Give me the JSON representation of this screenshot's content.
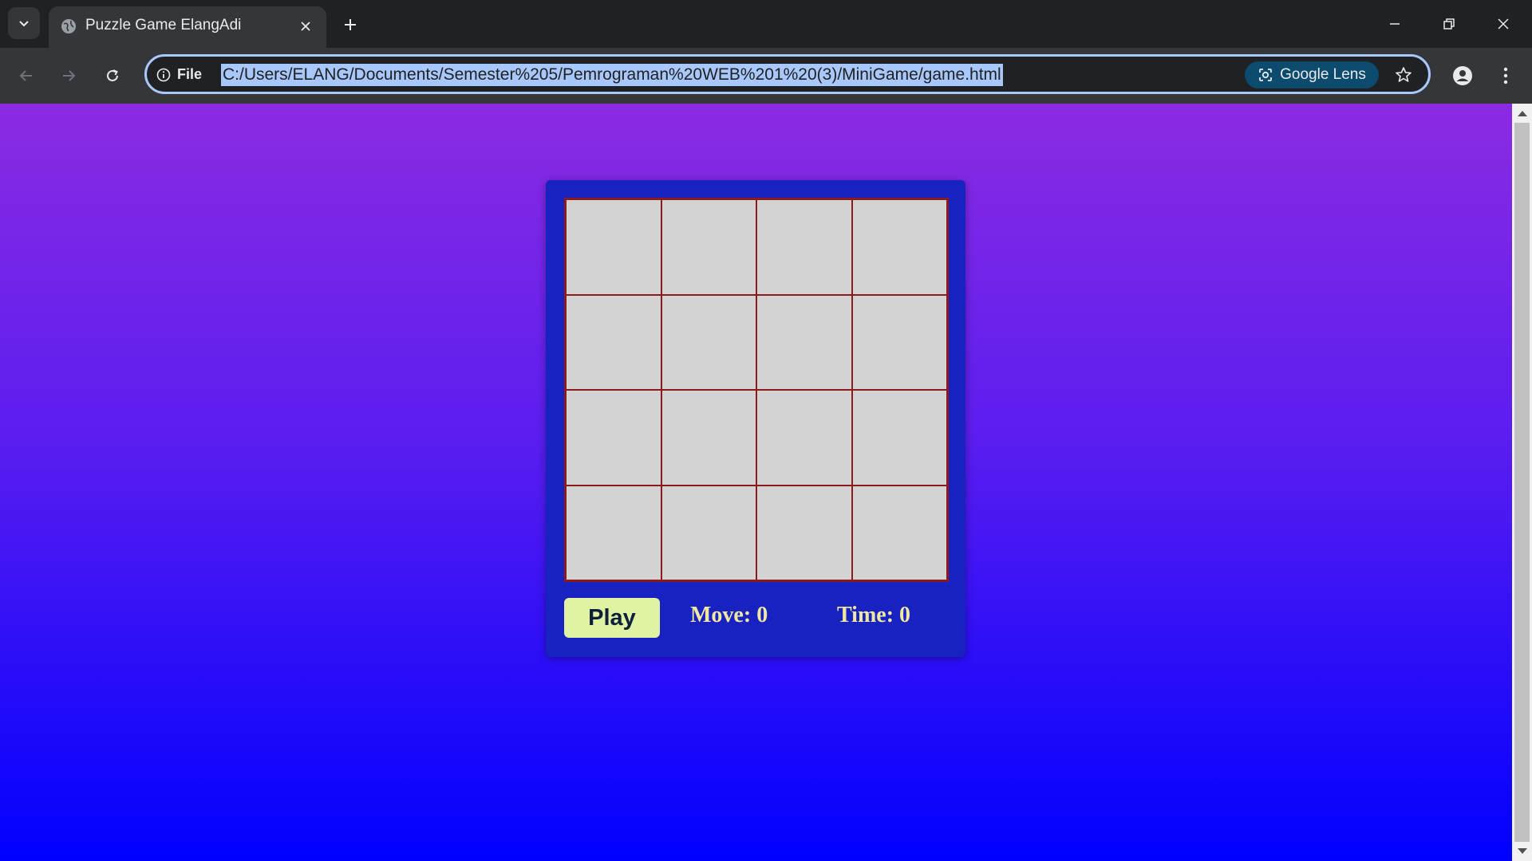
{
  "browser": {
    "tab": {
      "title": "Puzzle Game ElangAdi"
    },
    "omnibox": {
      "scheme_label": "File",
      "url": "C:/Users/ELANG/Documents/Semester%205/Pemrograman%20WEB%201%20(3)/MiniGame/game.html"
    },
    "lens_label": "Google Lens"
  },
  "game": {
    "grid_rows": 4,
    "grid_cols": 4,
    "play_label": "Play",
    "move_label": "Move:",
    "move_value": "0",
    "time_label": "Time:",
    "time_value": "0"
  },
  "colors": {
    "bg_top": "#8b2be2",
    "bg_bottom": "#0000ff",
    "panel": "#1722c0",
    "cell": "#d3d3d3",
    "cell_border": "#8b1a1a",
    "play_button": "#dff3a3",
    "stats_text": "#f0e8a0"
  }
}
